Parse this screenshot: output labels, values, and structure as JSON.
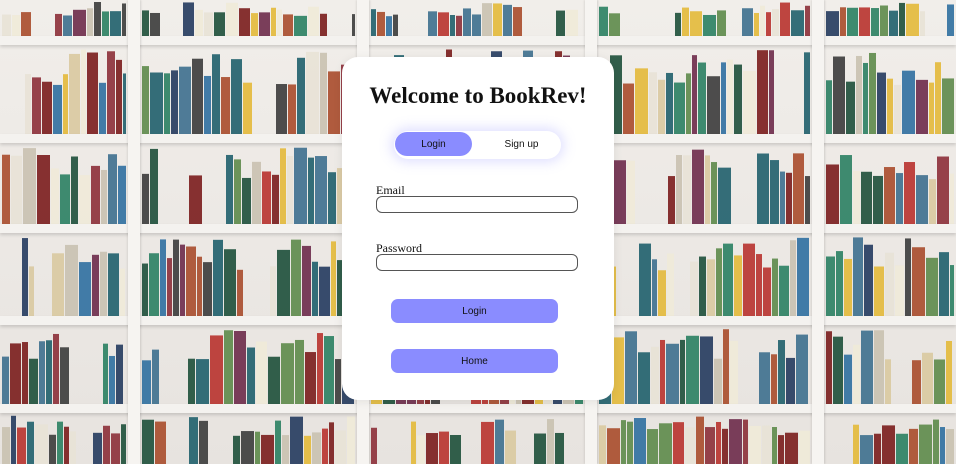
{
  "card": {
    "title": "Welcome to BookRev!"
  },
  "tabs": {
    "login_label": "Login",
    "signup_label": "Sign up",
    "active": "login"
  },
  "form": {
    "email_label": "Email",
    "email_value": "",
    "password_label": "Password",
    "password_value": ""
  },
  "buttons": {
    "login_label": "Login",
    "home_label": "Home"
  },
  "colors": {
    "accent": "#8a8cff",
    "card_background": "#ffffff"
  }
}
